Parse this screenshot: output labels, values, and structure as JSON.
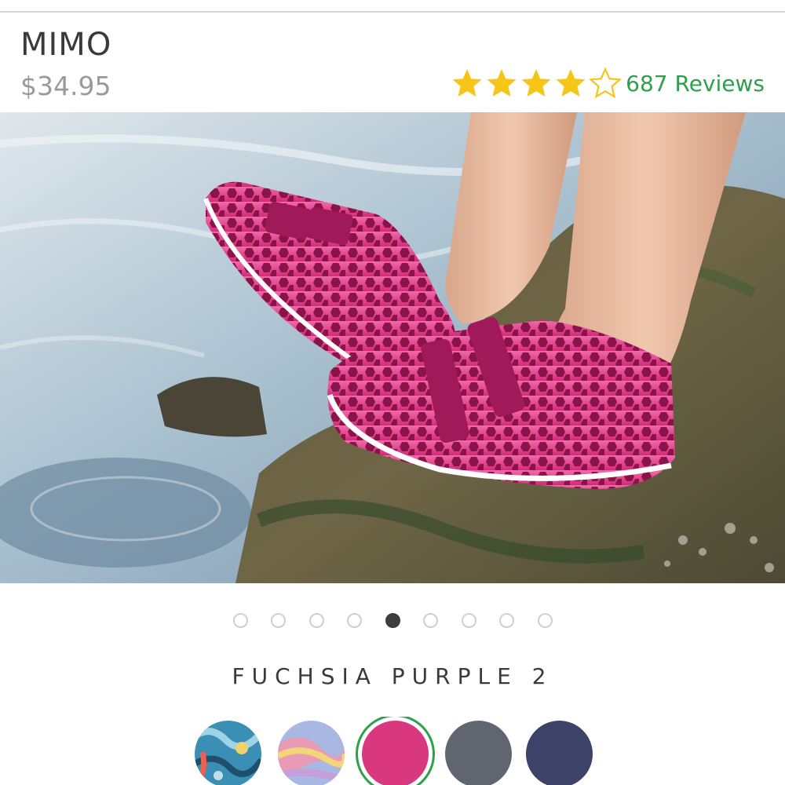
{
  "product": {
    "name": "MIMO",
    "price": "$34.95",
    "rating": 4,
    "rating_max": 5,
    "reviews_label": "687 Reviews",
    "star_color": "#f5c518",
    "reviews_color": "#2f9f4e"
  },
  "carousel": {
    "slide_count": 9,
    "active_index": 4
  },
  "color": {
    "selected_name": "FUCHSIA PURPLE 2",
    "swatches": [
      {
        "name": "multicolor-pattern-blue"
      },
      {
        "name": "marble-pastel"
      },
      {
        "name": "fuchsia-purple",
        "color": "#d9387e",
        "selected": true
      },
      {
        "name": "grey",
        "color": "#5f666f"
      },
      {
        "name": "navy",
        "color": "#3c4268"
      }
    ]
  }
}
